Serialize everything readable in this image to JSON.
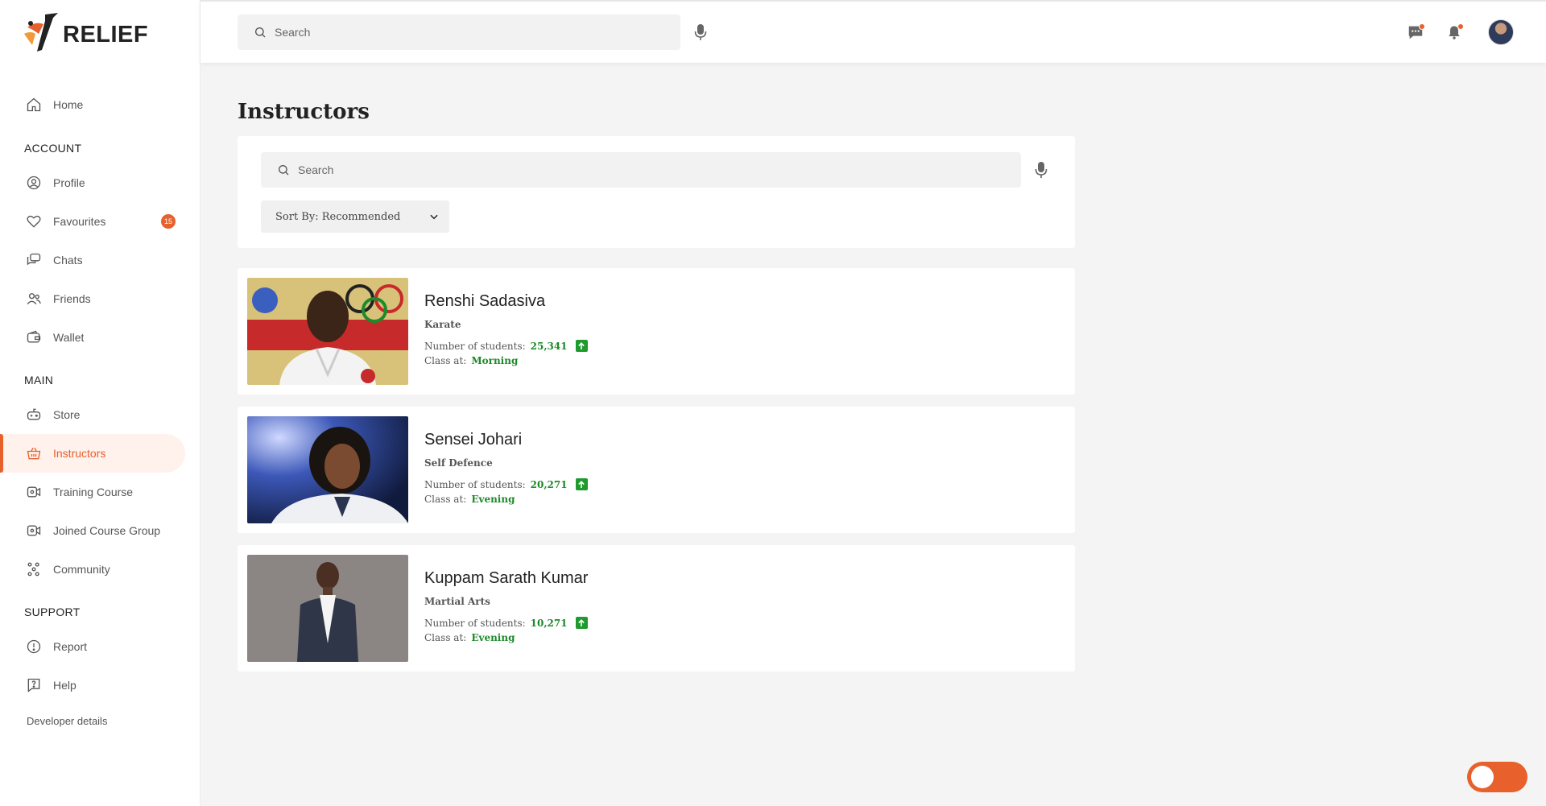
{
  "app": {
    "brand": "RELIEF"
  },
  "header": {
    "search_placeholder": "Search"
  },
  "sidebar": {
    "home": "Home",
    "account_label": "ACCOUNT",
    "profile": "Profile",
    "favourites": "Favourites",
    "favourites_badge": "15",
    "chats": "Chats",
    "friends": "Friends",
    "wallet": "Wallet",
    "main_label": "MAIN",
    "store": "Store",
    "instructors": "Instructors",
    "training_course": "Training Course",
    "joined_course_group": "Joined Course Group",
    "community": "Community",
    "support_label": "SUPPORT",
    "report": "Report",
    "help": "Help",
    "developer_details": "Developer details"
  },
  "main": {
    "title": "Instructors",
    "search_placeholder": "Search",
    "sort_label": "Sort By: Recommended",
    "students_label": "Number of students:",
    "class_label": "Class at:",
    "instructors": [
      {
        "name": "Renshi Sadasiva",
        "discipline": "Karate",
        "students": "25,341",
        "class_time": "Morning"
      },
      {
        "name": "Sensei Johari",
        "discipline": "Self Defence",
        "students": "20,271",
        "class_time": "Evening"
      },
      {
        "name": "Kuppam Sarath Kumar",
        "discipline": "Martial Arts",
        "students": "10,271",
        "class_time": "Evening"
      }
    ]
  },
  "colors": {
    "accent": "#e8602c",
    "success": "#1e8a2a"
  }
}
